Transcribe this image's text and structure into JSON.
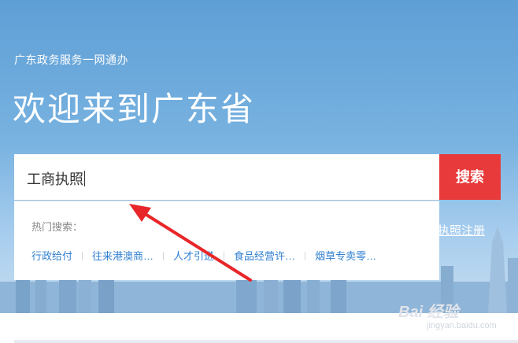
{
  "header": {
    "subtitle": "广东政务服务一网通办",
    "title": "欢迎来到广东省"
  },
  "search": {
    "value": "工商执照",
    "button_label": "搜索"
  },
  "hot_search": {
    "label": "热门搜索：",
    "items": [
      {
        "label": "行政给付"
      },
      {
        "label": "往来港澳商…"
      },
      {
        "label": "人才引进"
      },
      {
        "label": "食品经营许…"
      },
      {
        "label": "烟草专卖零…"
      }
    ]
  },
  "side_link": {
    "label": "执照注册"
  },
  "watermark": {
    "logo": "Bai 经验",
    "url": "jingyan.baidu.com"
  },
  "colors": {
    "accent_red": "#e83a3a",
    "link_blue": "#2f7fd1",
    "arrow_red": "#e8262a",
    "hero_blue": "#5e9fd6"
  }
}
